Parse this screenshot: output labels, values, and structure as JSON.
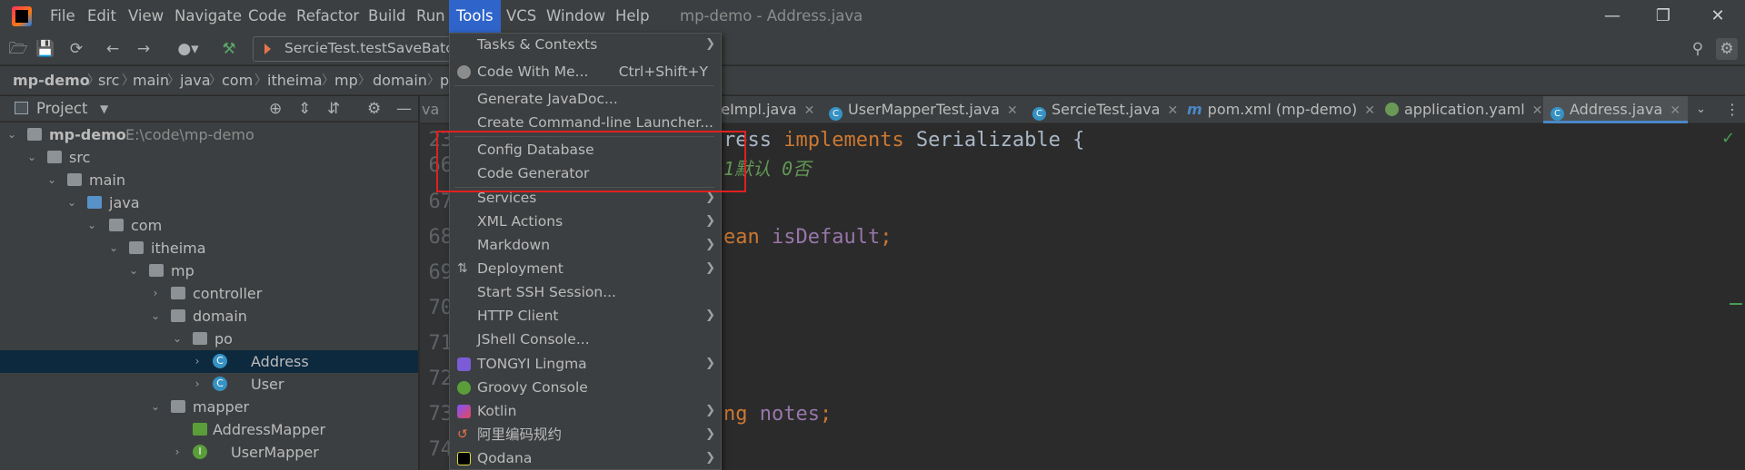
{
  "menubar": {
    "items": [
      "File",
      "Edit",
      "View",
      "Navigate",
      "Code",
      "Refactor",
      "Build",
      "Run",
      "Tools",
      "VCS",
      "Window",
      "Help"
    ],
    "active": "Tools",
    "title": "mp-demo - Address.java"
  },
  "toolbar": {
    "run_config": "SercieTest.testSaveBatch"
  },
  "breadcrumb": [
    "mp-demo",
    "src",
    "main",
    "java",
    "com",
    "itheima",
    "mp",
    "domain",
    "p"
  ],
  "breadcrumb_tail": "va",
  "project": {
    "header": "Project",
    "root_name": "mp-demo",
    "root_path": "E:\\code\\mp-demo",
    "tree": [
      "src",
      "main",
      "java",
      "com",
      "itheima",
      "mp",
      "controller",
      "domain",
      "po",
      "Address",
      "User",
      "mapper",
      "AddressMapper",
      "UserMapper"
    ]
  },
  "tabs": [
    {
      "label": "iceImpl.java",
      "icon": "class-icon"
    },
    {
      "label": "UserMapperTest.java",
      "icon": "test-class-icon"
    },
    {
      "label": "SercieTest.java",
      "icon": "test-class-icon"
    },
    {
      "label": "pom.xml (mp-demo)",
      "icon": "maven-icon"
    },
    {
      "label": "application.yaml",
      "icon": "spring-icon"
    },
    {
      "label": "Address.java",
      "icon": "class-icon"
    }
  ],
  "editor": {
    "line_numbers": [
      "23",
      "66",
      "67",
      "68",
      "69",
      "70",
      "71",
      "72",
      "73",
      "74"
    ],
    "line23_a": "ress ",
    "line23_kw": "implements",
    "line23_b": " Serializable {",
    "line66_comment": "1默认 0否",
    "line68_kw": "ean ",
    "line68_field": "isDefault",
    "line68_semi": ";",
    "line73_kw": "ng ",
    "line73_field": "notes",
    "line73_semi": ";"
  },
  "tools_menu": {
    "items": [
      {
        "label": "Tasks & Contexts",
        "submenu": true
      },
      {
        "label": "Code With Me...",
        "shortcut": "Ctrl+Shift+Y"
      },
      {
        "label": "Generate JavaDoc..."
      },
      {
        "label": "Create Command-line Launcher..."
      },
      {
        "label": "Config Database"
      },
      {
        "label": "Code Generator"
      },
      {
        "label": "Services",
        "submenu": true
      },
      {
        "label": "XML Actions",
        "submenu": true
      },
      {
        "label": "Markdown",
        "submenu": true
      },
      {
        "label": "Deployment",
        "submenu": true
      },
      {
        "label": "Start SSH Session..."
      },
      {
        "label": "HTTP Client",
        "submenu": true
      },
      {
        "label": "JShell Console..."
      },
      {
        "label": "TONGYI Lingma",
        "submenu": true
      },
      {
        "label": "Groovy Console"
      },
      {
        "label": "Kotlin",
        "submenu": true
      },
      {
        "label": "阿里编码规约",
        "submenu": true
      },
      {
        "label": "Qodana",
        "submenu": true
      }
    ]
  },
  "colors": {
    "accent": "#2f65ca",
    "highlight_box": "#e02020",
    "keyword": "#cc7832",
    "field": "#9876aa"
  }
}
